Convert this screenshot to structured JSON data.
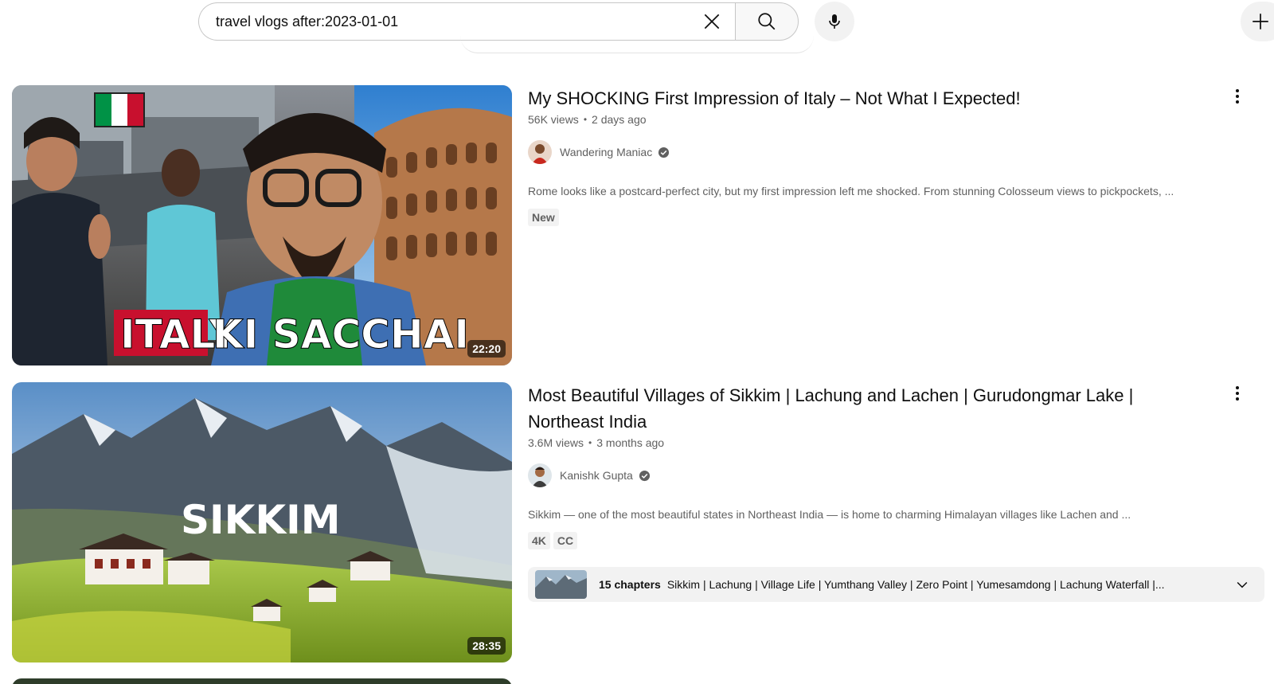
{
  "search": {
    "query": "travel vlogs after:2023-01-01"
  },
  "videos": [
    {
      "title": "My SHOCKING First Impression of Italy – Not What I Expected!",
      "views": "56K views",
      "age": "2 days ago",
      "channel": "Wandering Maniac",
      "description": "Rome looks like a postcard-perfect city, but my first impression left me shocked. From stunning Colosseum views to pickpockets, ...",
      "badges": [
        "New"
      ],
      "duration": "22:20",
      "thumb_text": [
        "ITALY",
        "KI SACCHAI"
      ]
    },
    {
      "title": "Most Beautiful Villages of Sikkim | Lachung and Lachen | Gurudongmar Lake | Northeast India",
      "views": "3.6M views",
      "age": "3 months ago",
      "channel": "Kanishk Gupta",
      "description": "Sikkim — one of the most beautiful states in Northeast India — is home to charming Himalayan villages like Lachen and ...",
      "badges": [
        "4K",
        "CC"
      ],
      "duration": "28:35",
      "thumb_text": "SIKKIM",
      "chapters": {
        "count": "15 chapters",
        "list": "Sikkim | Lachung | Village Life | Yumthang Valley | Zero Point | Yumesamdong | Lachung Waterfall |..."
      }
    }
  ],
  "icons": {
    "clear": "close-icon",
    "search": "search-icon",
    "mic": "mic-icon",
    "create": "plus-icon",
    "menu": "more-vert-icon",
    "verified": "verified-check-icon",
    "expand": "chevron-down-icon"
  },
  "colors": {
    "badge_bg": "#f2f2f2",
    "secondary_text": "#606060",
    "italy_red": "#c8102e",
    "italy_green": "#009246"
  }
}
